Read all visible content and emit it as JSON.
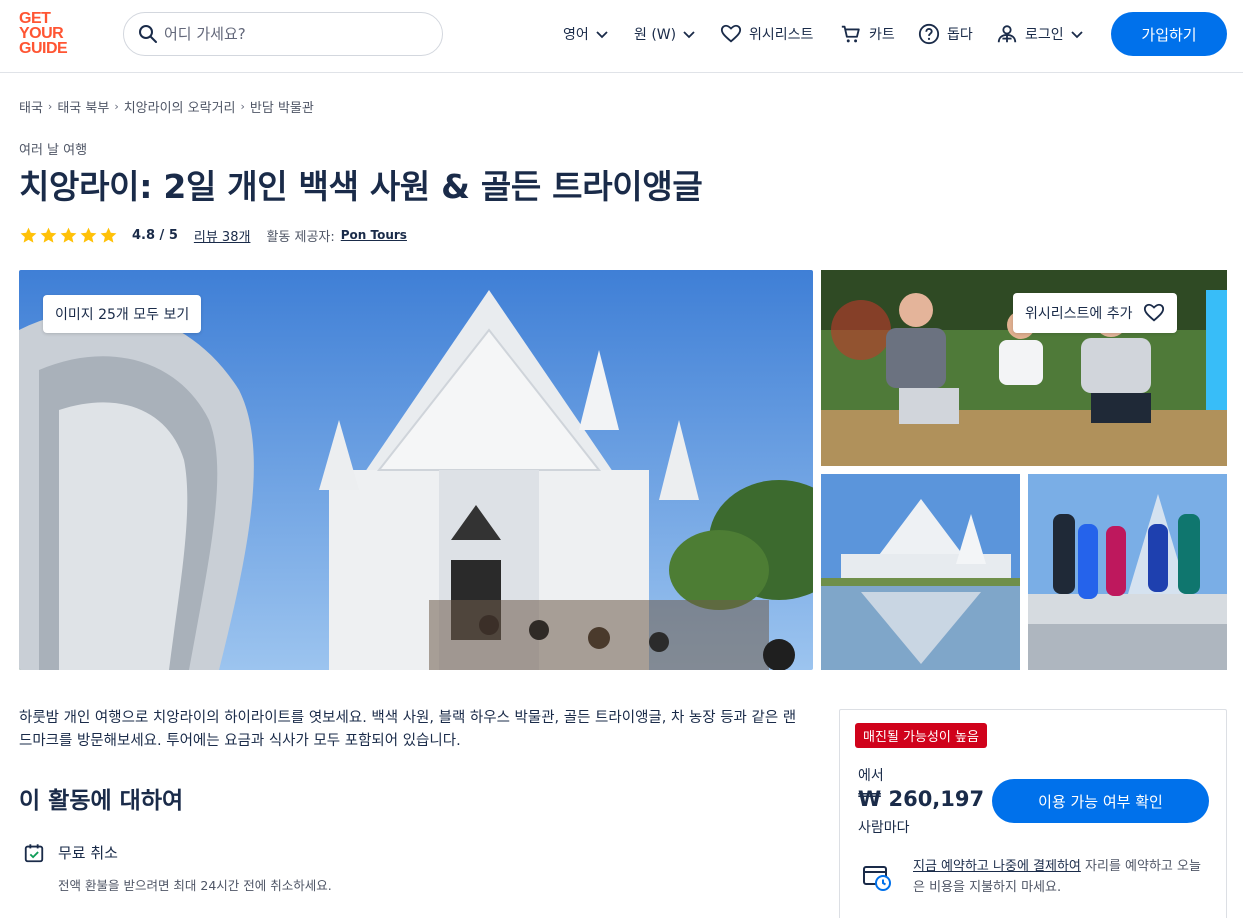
{
  "header": {
    "logo": [
      "GET",
      "YOUR",
      "GUIDE"
    ],
    "search_placeholder": "어디 가세요?",
    "language": "영어",
    "currency": "원 (W)",
    "wishlist": "위시리스트",
    "cart": "카트",
    "help": "돕다",
    "login": "로그인",
    "signup": "가입하기"
  },
  "breadcrumbs": [
    "태국",
    "태국 북부",
    "치앙라이의 오락거리",
    "반담 박물관"
  ],
  "activity": {
    "category": "여러 날 여행",
    "title": "치앙라이: 2일 개인 백색 사원 & 골든 트라이앵글",
    "rating": "4.8 / 5",
    "stars": 5,
    "reviews": "리뷰 38개",
    "provider_label": "활동 제공자:",
    "provider": "Pon Tours"
  },
  "gallery": {
    "view_all": "이미지 25개 모두 보기",
    "wishlist_add": "위시리스트에 추가"
  },
  "description": "하룻밤 개인 여행으로 치앙라이의 하이라이트를 엿보세요. 백색 사원, 블랙 하우스 박물관, 골든 트라이앵글, 차 농장 등과 같은 랜드마크를 방문해보세요. 투어에는 요금과 식사가 모두 포함되어 있습니다.",
  "about": {
    "heading": "이 활동에 대하여",
    "features": [
      {
        "title": "무료 취소",
        "desc": "전액 환불을 받으려면 최대 24시간 전에 취소하세요."
      }
    ]
  },
  "booking": {
    "badge": "매진될 가능성이 높음",
    "from": "에서",
    "price": "₩ 260,197",
    "per": "사람마다",
    "check_button": "이용 가능 여부 확인",
    "rnpl_link": "지금 예약하고 나중에 결제하여",
    "rnpl_text": " 자리를 예약하고 오늘은 비용을 지불하지 마세요."
  },
  "colors": {
    "primary": "#0071eb",
    "brand": "#ff5533",
    "text": "#1a2b49",
    "badge": "#d0021b",
    "star": "#ffc107"
  }
}
